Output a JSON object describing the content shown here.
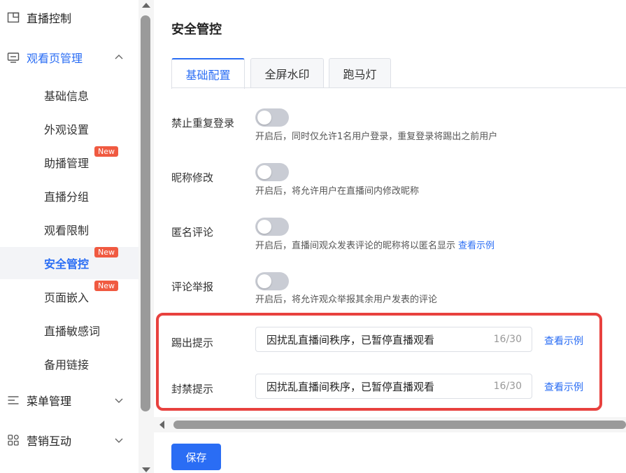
{
  "sidebar": {
    "groups": [
      {
        "label": "直播控制",
        "icon": "window-icon"
      },
      {
        "label": "观看页管理",
        "icon": "monitor-icon",
        "expanded": true
      },
      {
        "label": "菜单管理",
        "icon": "menu-icon"
      },
      {
        "label": "营销互动",
        "icon": "grid-icon"
      }
    ],
    "items": [
      {
        "label": "基础信息"
      },
      {
        "label": "外观设置"
      },
      {
        "label": "助播管理",
        "badge": "New"
      },
      {
        "label": "直播分组"
      },
      {
        "label": "观看限制"
      },
      {
        "label": "安全管控",
        "badge": "New",
        "active": true
      },
      {
        "label": "页面嵌入",
        "badge": "New"
      },
      {
        "label": "直播敏感词"
      },
      {
        "label": "备用链接"
      }
    ]
  },
  "main": {
    "title": "安全管控",
    "tabs": [
      {
        "label": "基础配置",
        "active": true
      },
      {
        "label": "全屏水印"
      },
      {
        "label": "跑马灯"
      }
    ],
    "toggles": [
      {
        "label": "禁止重复登录",
        "on": false,
        "desc": "开启后，同时仅允许1名用户登录，重复登录将踢出之前用户"
      },
      {
        "label": "昵称修改",
        "on": false,
        "desc": "开启后，将允许用户在直播间内修改昵称"
      },
      {
        "label": "匿名评论",
        "on": false,
        "desc": "开启后，直播间观众发表评论的昵称将以匿名显示",
        "link": "查看示例"
      },
      {
        "label": "评论举报",
        "on": false,
        "desc": "开启后，将允许观众举报其余用户发表的评论"
      }
    ],
    "fields": [
      {
        "label": "踢出提示",
        "value": "因扰乱直播间秩序，已暂停直播观看",
        "count": "16/30",
        "link": "查看示例"
      },
      {
        "label": "封禁提示",
        "value": "因扰乱直播间秩序，已暂停直播观看",
        "count": "16/30",
        "link": "查看示例"
      }
    ],
    "save_label": "保存"
  },
  "colors": {
    "accent": "#2a6df4",
    "badge": "#f05a41",
    "highlight": "#e8413e"
  }
}
